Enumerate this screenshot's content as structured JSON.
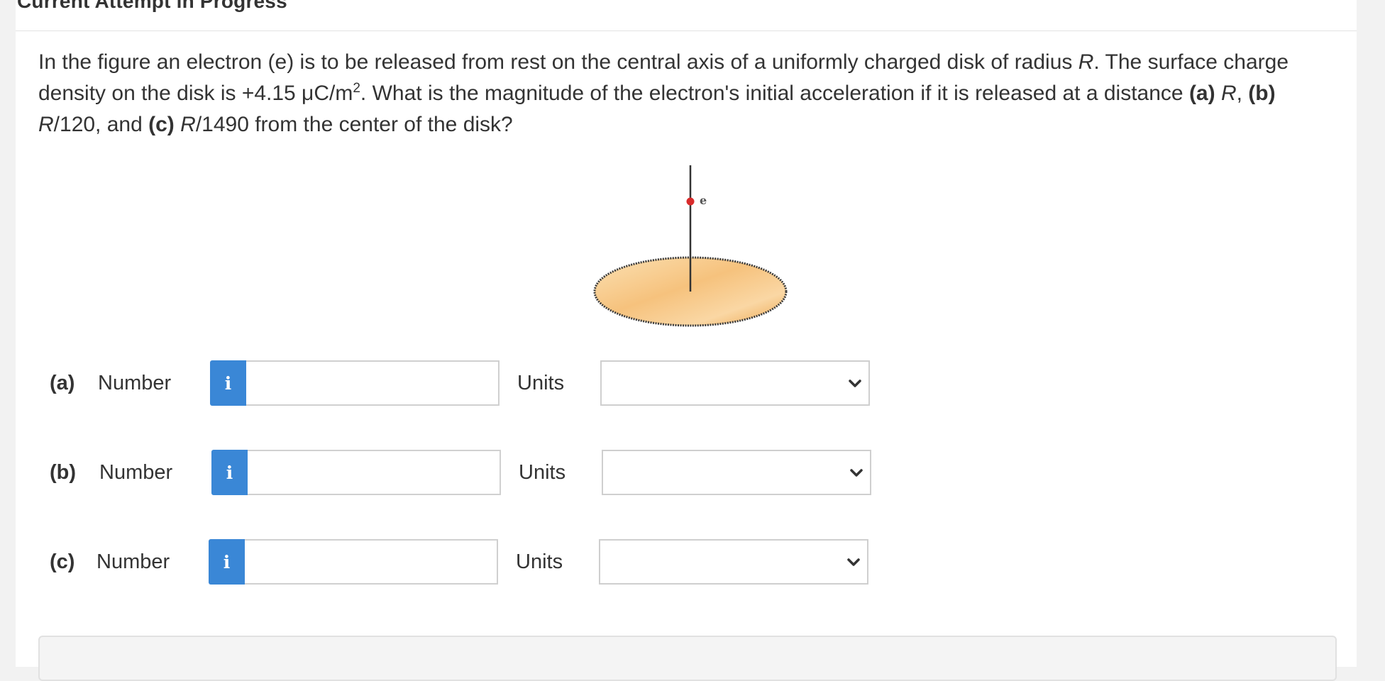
{
  "header": {
    "title": "Current Attempt in Progress"
  },
  "question": {
    "t1": "In the figure an electron (e) is to be released from rest on the central axis of a uniformly charged disk of radius ",
    "r1": "R",
    "t2": ". The surface charge density on the disk is +4.15 μC/m",
    "sup": "2",
    "t3": ". What is the magnitude of the electron's initial acceleration if it is released at a distance ",
    "pa": "(a)",
    "t4": " ",
    "r2": "R",
    "t5": ", ",
    "pb": "(b)",
    "t6": " ",
    "r3": "R",
    "t7": "/120, and ",
    "pc": "(c)",
    "t8": " ",
    "r4": "R",
    "t9": "/1490 from the center of the disk?"
  },
  "figure": {
    "electron_label": "e",
    "colors": {
      "disk_light": "#fbe0b2",
      "disk_dark": "#eda64e",
      "electron": "#d92b2b",
      "axis": "#333333"
    }
  },
  "answers": [
    {
      "part": "(a)",
      "number_label": "Number",
      "info_icon": "i",
      "value": "",
      "units_label": "Units",
      "units_value": ""
    },
    {
      "part": "(b)",
      "number_label": "Number",
      "info_icon": "i",
      "value": "",
      "units_label": "Units",
      "units_value": ""
    },
    {
      "part": "(c)",
      "number_label": "Number",
      "info_icon": "i",
      "value": "",
      "units_label": "Units",
      "units_value": ""
    }
  ],
  "colors": {
    "info_button": "#3a87d6",
    "background": "#f2f2f2",
    "card": "#ffffff"
  }
}
